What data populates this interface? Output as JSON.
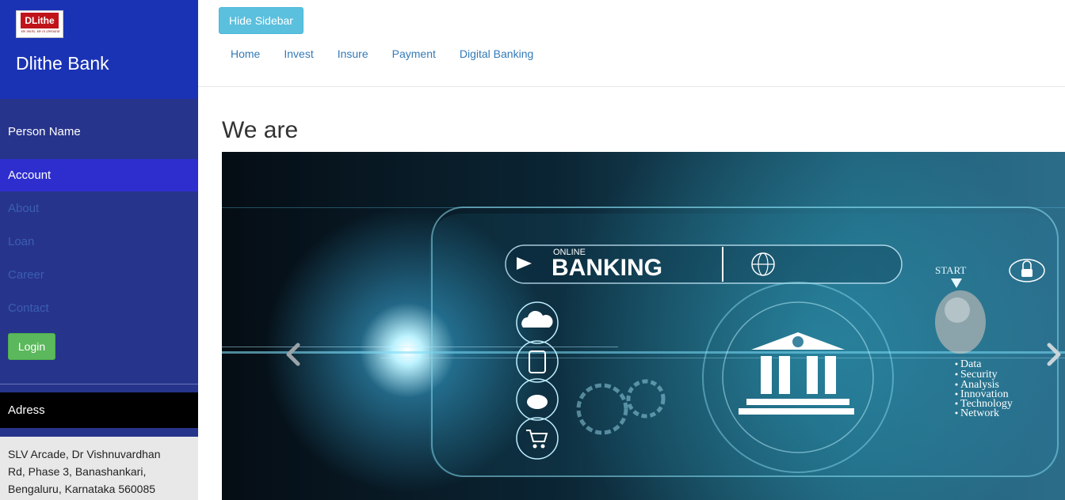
{
  "sidebar": {
    "logo_text": "DLithe",
    "logo_tagline": "Be Skills. Be in Demand",
    "bank_name": "Dlithe Bank",
    "person_name": "Person Name",
    "active_item": "Account",
    "items": [
      {
        "label": "About"
      },
      {
        "label": "Loan"
      },
      {
        "label": "Career"
      },
      {
        "label": "Contact"
      }
    ],
    "login_label": "Login",
    "address_title": "Adress",
    "address_lines": [
      "SLV Arcade, Dr Vishnuvardhan",
      "Rd, Phase 3, Banashankari,",
      "Bengaluru, Karnataka 560085"
    ]
  },
  "topbar": {
    "hide_sidebar_label": "Hide Sidebar",
    "nav": [
      {
        "label": "Home"
      },
      {
        "label": "Invest"
      },
      {
        "label": "Insure"
      },
      {
        "label": "Payment"
      },
      {
        "label": "Digital Banking"
      }
    ]
  },
  "main": {
    "heading": "We are",
    "banner": {
      "online_label": "ONLINE",
      "banking_label": "BANKING",
      "start_label": "START",
      "features": [
        "Data",
        "Security",
        "Analysis",
        "Innovation",
        "Technology",
        "Network"
      ],
      "prev_icon": "chevron-left-icon",
      "next_icon": "chevron-right-icon"
    }
  },
  "colors": {
    "sidebar_bg": "#27348b",
    "brand_bg": "#1a33b5",
    "active_item_bg": "#2e2ecf",
    "link": "#337ab7",
    "login_button": "#5cb85c",
    "hide_button": "#5bc0de"
  }
}
